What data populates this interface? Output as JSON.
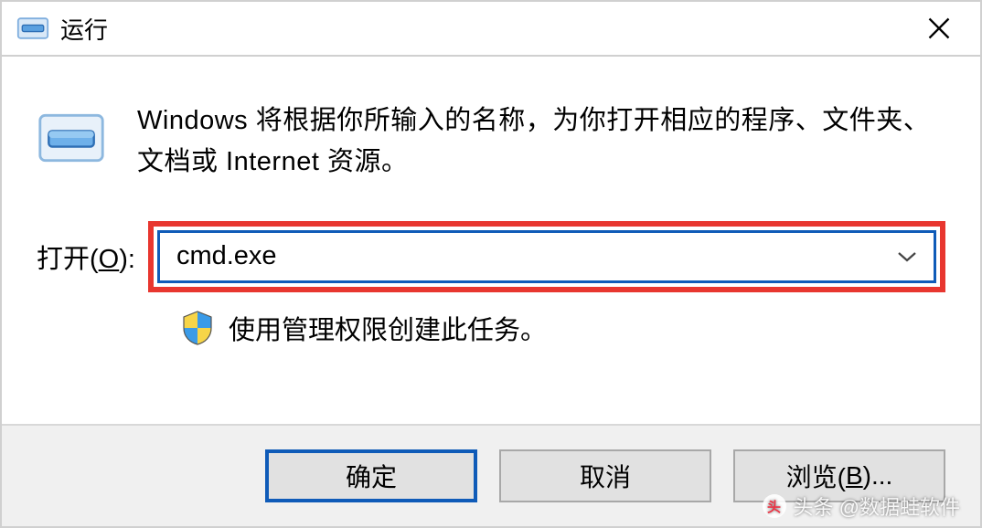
{
  "titlebar": {
    "title": "运行"
  },
  "content": {
    "description": "Windows 将根据你所输入的名称，为你打开相应的程序、文件夹、文档或 Internet 资源。",
    "open_label_prefix": "打开(",
    "open_label_accel": "O",
    "open_label_suffix": "):",
    "input_value": "cmd.exe",
    "admin_note": "使用管理权限创建此任务。"
  },
  "buttons": {
    "ok": "确定",
    "cancel": "取消",
    "browse_prefix": "浏览(",
    "browse_accel": "B",
    "browse_suffix": ")..."
  },
  "watermark": {
    "text": "头条 @数据蛙软件"
  }
}
